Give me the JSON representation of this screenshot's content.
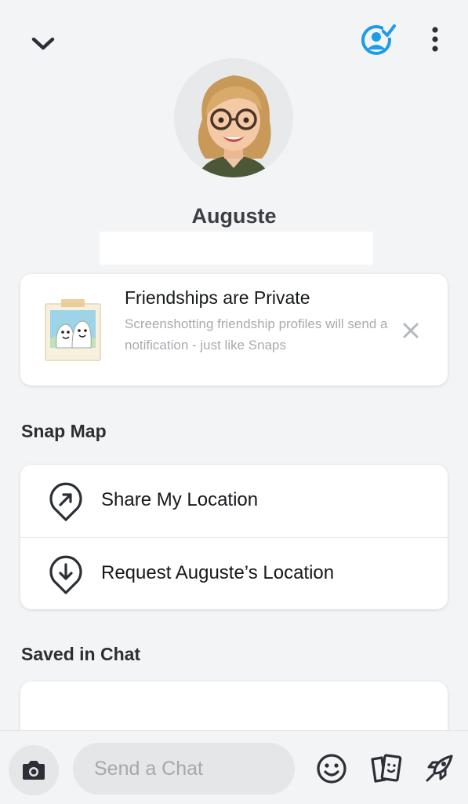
{
  "header": {
    "back_icon": "chevron-down-icon",
    "story_icon": "add-story-icon",
    "more_icon": "more-vertical-icon"
  },
  "profile": {
    "display_name": "Auguste",
    "avatar": "bitmoji-avatar"
  },
  "privacy_card": {
    "title": "Friendships are Private",
    "body": "Screenshotting friendship profiles will send a notification - just like Snaps",
    "close_icon": "close-icon"
  },
  "snap_map": {
    "title": "Snap Map",
    "items": [
      {
        "label": "Share My Location",
        "icon": "location-share-icon"
      },
      {
        "label": "Request Auguste’s Location",
        "icon": "location-request-icon"
      }
    ]
  },
  "saved_in_chat": {
    "title": "Saved in Chat"
  },
  "chat_bar": {
    "placeholder": "Send a Chat",
    "value": "",
    "icons": [
      "camera-icon",
      "emoji-icon",
      "stickers-icon",
      "rocket-icon"
    ]
  },
  "colors": {
    "accent_blue": "#1e9be9",
    "background": "#f3f4f5",
    "card": "#ffffff",
    "muted_text": "#a7abaf"
  }
}
